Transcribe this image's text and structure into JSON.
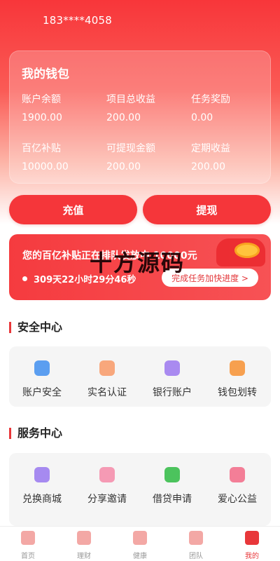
{
  "header": {
    "phone": "183****4058"
  },
  "wallet": {
    "title": "我的钱包",
    "stats": [
      {
        "label": "账户余额",
        "value": "1900.00"
      },
      {
        "label": "项目总收益",
        "value": "200.00"
      },
      {
        "label": "任务奖励",
        "value": "0.00"
      },
      {
        "label": "百亿补贴",
        "value": "10000.00"
      },
      {
        "label": "可提现金额",
        "value": "200.00"
      },
      {
        "label": "定期收益",
        "value": "200.00"
      }
    ]
  },
  "actions": {
    "recharge": "充值",
    "withdraw": "提现"
  },
  "subsidy": {
    "text": "您的百亿补贴正在排队发放中 10000元",
    "timer": "309天22小时29分46秒",
    "link": "完成任务加快进度 >"
  },
  "watermark": "十方源码",
  "security": {
    "title": "安全中心",
    "items": [
      {
        "label": "账户安全",
        "icon": "shield-icon",
        "color": "#5b9ef0"
      },
      {
        "label": "实名认证",
        "icon": "id-card-icon",
        "color": "#f8a77c"
      },
      {
        "label": "银行账户",
        "icon": "bank-card-icon",
        "color": "#a98af0"
      },
      {
        "label": "钱包划转",
        "icon": "transfer-icon",
        "color": "#f7a04f"
      }
    ]
  },
  "services": {
    "title": "服务中心",
    "items": [
      {
        "label": "兑换商城",
        "icon": "cart-icon",
        "color": "#a68af0"
      },
      {
        "label": "分享邀请",
        "icon": "share-icon",
        "color": "#f59ab4"
      },
      {
        "label": "借贷申请",
        "icon": "loan-icon",
        "color": "#4cc35d"
      },
      {
        "label": "爱心公益",
        "icon": "heart-icon",
        "color": "#f37e97"
      }
    ]
  },
  "tabs": [
    {
      "label": "首页",
      "icon": "home-icon"
    },
    {
      "label": "理财",
      "icon": "piggy-bank-icon"
    },
    {
      "label": "健康",
      "icon": "health-icon"
    },
    {
      "label": "团队",
      "icon": "team-icon"
    },
    {
      "label": "我的",
      "icon": "user-icon",
      "active": true
    }
  ]
}
